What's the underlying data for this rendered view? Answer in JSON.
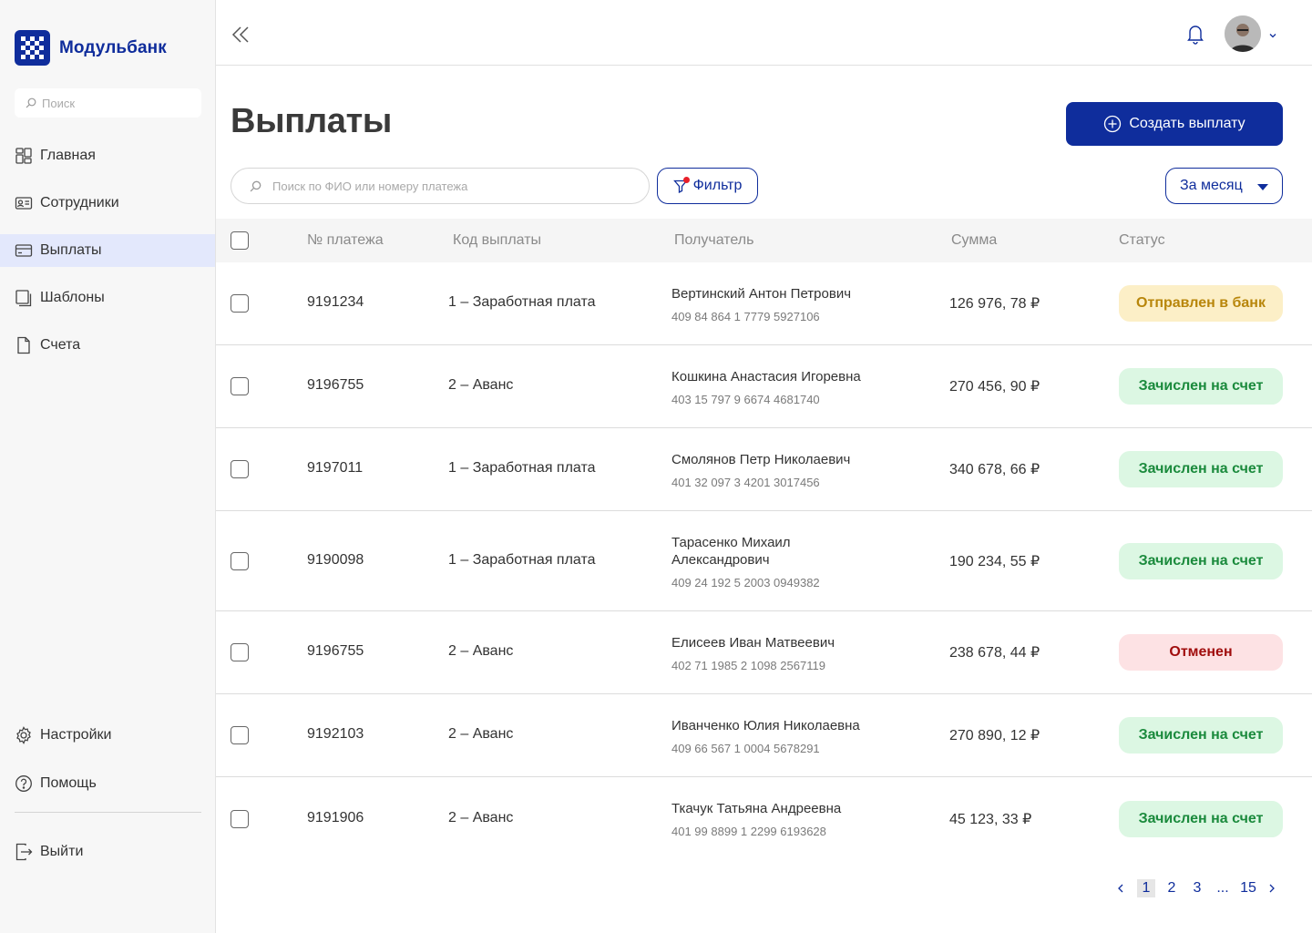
{
  "brand": {
    "name": "Модульбанк",
    "color": "#0f2d9c"
  },
  "sidebar": {
    "search_placeholder": "Поиск",
    "items": [
      {
        "label": "Главная",
        "icon": "home-icon"
      },
      {
        "label": "Сотрудники",
        "icon": "id-card-icon"
      },
      {
        "label": "Выплаты",
        "icon": "card-icon",
        "active": true
      },
      {
        "label": "Шаблоны",
        "icon": "templates-icon"
      },
      {
        "label": "Счета",
        "icon": "document-icon"
      }
    ],
    "bottom_items": [
      {
        "label": "Настройки",
        "icon": "gear-icon"
      },
      {
        "label": "Помощь",
        "icon": "help-icon"
      }
    ],
    "logout_label": "Выйти"
  },
  "header": {
    "bell_icon": "bell-icon",
    "avatar": "user-avatar"
  },
  "main": {
    "title": "Выплаты",
    "create_label": "Создать выплату",
    "search_placeholder": "Поиск по ФИО или номеру платежа",
    "filter_label": "Фильтр",
    "period_label": "За месяц"
  },
  "table": {
    "headers": {
      "num": "№ платежа",
      "code": "Код выплаты",
      "recipient": "Получатель",
      "sum": "Сумма",
      "status": "Статус"
    },
    "rows": [
      {
        "num": "9191234",
        "code": "1 – Заработная плата",
        "name": "Вертинский Антон Петрович",
        "account": "409 84 864 1 7779 5927106",
        "sum": "126 976, 78 ₽",
        "status": "Отправлен в банк",
        "status_type": "sent"
      },
      {
        "num": "9196755",
        "code": "2 – Аванс",
        "name": "Кошкина Анастасия Игоревна",
        "account": "403 15 797 9 6674 4681740",
        "sum": "270 456, 90 ₽",
        "status": "Зачислен на счет",
        "status_type": "ok"
      },
      {
        "num": "9197011",
        "code": "1 – Заработная плата",
        "name": "Смолянов Петр Николаевич",
        "account": "401 32 097 3 4201 3017456",
        "sum": "340 678, 66 ₽",
        "status": "Зачислен на счет",
        "status_type": "ok"
      },
      {
        "num": "9190098",
        "code": "1 – Заработная плата",
        "name": "Тарасенко Михаил Александрович",
        "account": "409 24 192 5 2003 0949382",
        "sum": "190 234, 55 ₽",
        "status": "Зачислен на счет",
        "status_type": "ok"
      },
      {
        "num": "9196755",
        "code": "2 – Аванс",
        "name": "Елисеев Иван Матвеевич",
        "account": "402 71 1985 2 1098 2567119",
        "sum": "238 678, 44 ₽",
        "status": "Отменен",
        "status_type": "cancel"
      },
      {
        "num": "9192103",
        "code": "2 – Аванс",
        "name": "Иванченко Юлия Николаевна",
        "account": "409 66 567 1 0004 5678291",
        "sum": "270 890, 12 ₽",
        "status": "Зачислен на счет",
        "status_type": "ok"
      },
      {
        "num": "9191906",
        "code": "2 – Аванс",
        "name": "Ткачук Татьяна Андреевна",
        "account": "401 99 8899 1 2299 6193628",
        "sum": "45 123, 33 ₽",
        "status": "Зачислен на счет",
        "status_type": "ok"
      }
    ]
  },
  "pagination": {
    "pages": [
      "1",
      "2",
      "3"
    ],
    "ellipsis": "...",
    "last": "15",
    "current": "1"
  },
  "colors": {
    "sent_bg": "#fcefc7",
    "sent_fg": "#b8860b",
    "ok_bg": "#dcf7e3",
    "ok_fg": "#1a8a3c",
    "cancel_bg": "#fde2e4",
    "cancel_fg": "#a00d0d"
  }
}
